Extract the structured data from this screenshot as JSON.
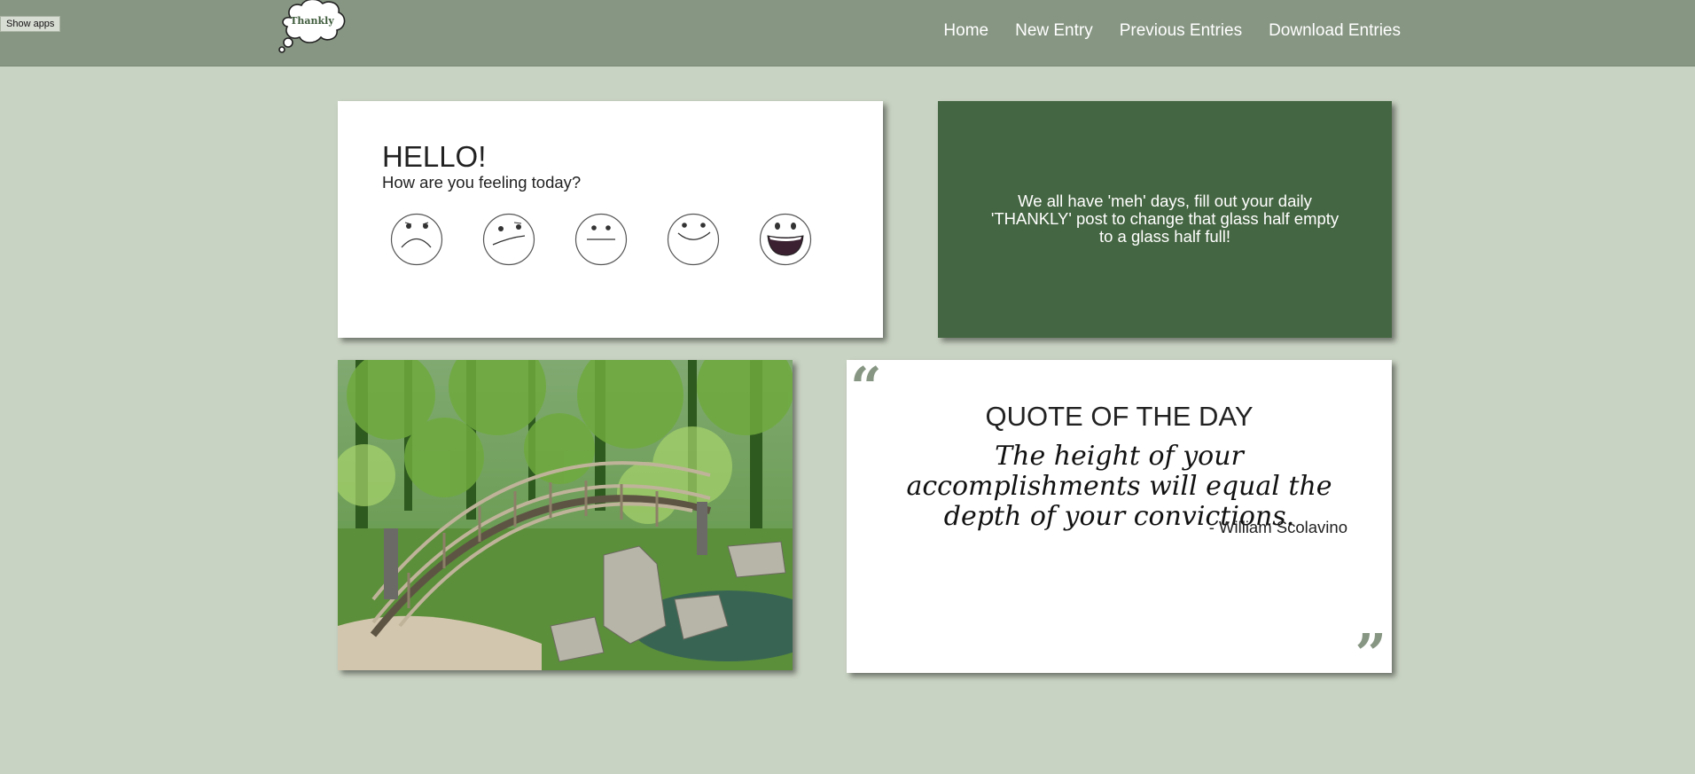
{
  "show_apps_label": "Show apps",
  "header": {
    "logo_text": "Thankly",
    "nav": [
      "Home",
      "New Entry",
      "Previous Entries",
      "Download Entries"
    ]
  },
  "hello": {
    "title": "HELLO!",
    "subtitle": "How are you feeling today?",
    "moods": [
      "very-sad-face-icon",
      "unsure-face-icon",
      "neutral-face-icon",
      "content-face-icon",
      "very-happy-face-icon"
    ]
  },
  "motto": {
    "text": "We all have 'meh' days, fill out your daily 'THANKLY' post to change that glass half empty to a glass half full!"
  },
  "photo": {
    "icon": "garden-bridge-photo"
  },
  "quote": {
    "title": "QUOTE OF THE DAY",
    "text": "The height of your accomplishments will equal the depth of your convictions.",
    "author": "- William Scolavino"
  },
  "colors": {
    "page_bg": "#c9d3c3",
    "header_bg": "#879683",
    "motto_bg": "#456642",
    "quote_mark": "#879683"
  }
}
